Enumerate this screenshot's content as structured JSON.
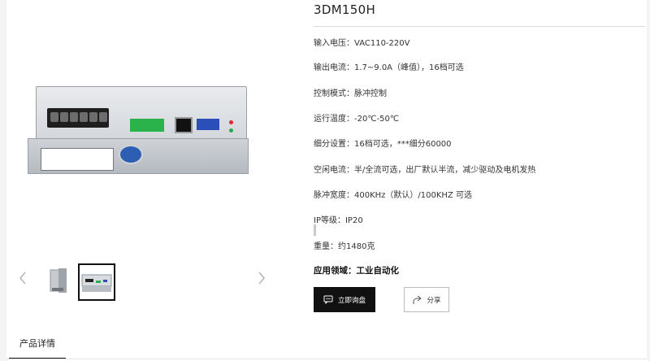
{
  "product": {
    "title": "3DM150H",
    "specs": [
      {
        "text": "输入电压：VAC110-220V"
      },
      {
        "text": "输出电流：1.7~9.0A（峰值），16档可选"
      },
      {
        "text": "控制模式：脉冲控制"
      },
      {
        "text": "运行温度：-20℃-50℃"
      },
      {
        "text": "细分设置：16档可选，***细分60000"
      },
      {
        "text": "空闲电流：半/全流可选，出厂默认半流，减少驱动及电机发热"
      },
      {
        "text": "脉冲宽度：400KHz（默认）/100KHZ 可选"
      },
      {
        "text": "IP等级：IP20"
      },
      {
        "text": "重量：约1480克"
      }
    ],
    "application": "应用领域：工业自动化"
  },
  "buttons": {
    "consult_label": "立即询盘",
    "share_label": "分享"
  },
  "tabs": {
    "details_label": "产品详情"
  },
  "gallery": {
    "selected_index": 2
  }
}
